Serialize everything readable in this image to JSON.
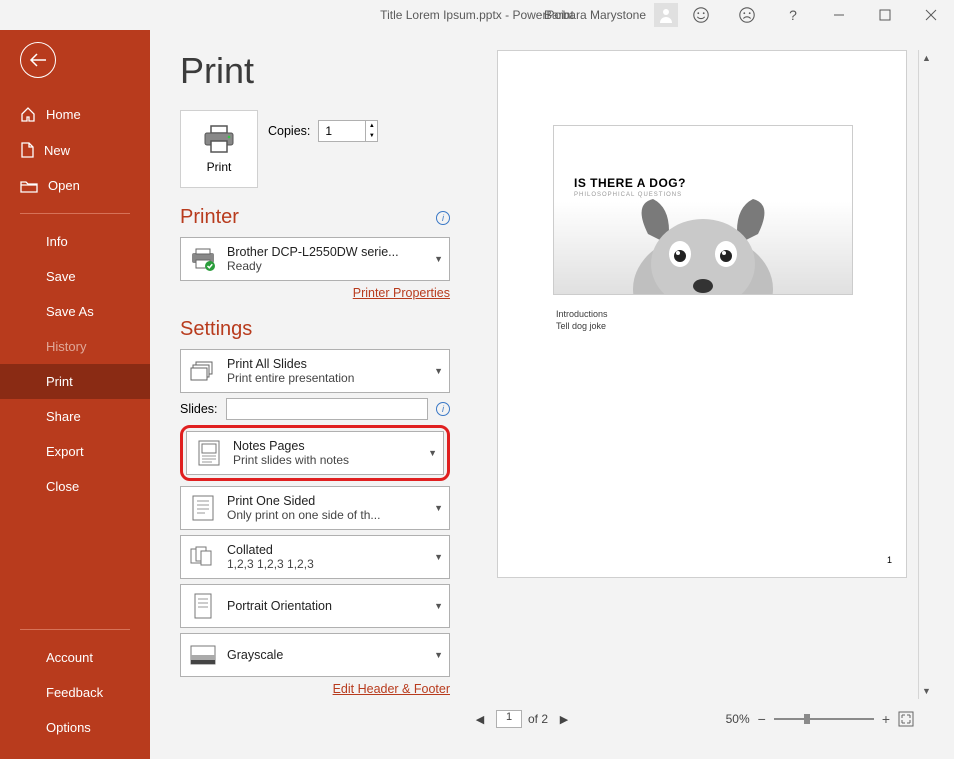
{
  "titlebar": {
    "title": "Title Lorem Ipsum.pptx  -  PowerPoint",
    "user": "Barbara Marystone"
  },
  "sidebar": {
    "top": [
      {
        "label": "Home",
        "icon": "home"
      },
      {
        "label": "New",
        "icon": "new"
      },
      {
        "label": "Open",
        "icon": "open"
      }
    ],
    "mid": [
      {
        "label": "Info"
      },
      {
        "label": "Save"
      },
      {
        "label": "Save As"
      },
      {
        "label": "History",
        "dim": true
      },
      {
        "label": "Print",
        "selected": true
      },
      {
        "label": "Share"
      },
      {
        "label": "Export"
      },
      {
        "label": "Close"
      }
    ],
    "bottom": [
      {
        "label": "Account"
      },
      {
        "label": "Feedback"
      },
      {
        "label": "Options"
      }
    ]
  },
  "print": {
    "pageTitle": "Print",
    "button": "Print",
    "copiesLabel": "Copies:",
    "copies": "1",
    "printer": {
      "heading": "Printer",
      "name": "Brother DCP-L2550DW serie...",
      "status": "Ready",
      "propertiesLink": "Printer Properties"
    },
    "settings": {
      "heading": "Settings",
      "items": [
        {
          "title": "Print All Slides",
          "sub": "Print entire presentation"
        },
        {
          "title": "Notes Pages",
          "sub": "Print slides with notes"
        },
        {
          "title": "Print One Sided",
          "sub": "Only print on one side of th..."
        },
        {
          "title": "Collated",
          "sub": "1,2,3    1,2,3    1,2,3"
        },
        {
          "title": "Portrait Orientation",
          "sub": ""
        },
        {
          "title": "Grayscale",
          "sub": ""
        }
      ],
      "slidesLabel": "Slides:",
      "editHeaderFooter": "Edit Header & Footer"
    }
  },
  "preview": {
    "slideTitle": "IS THERE A DOG?",
    "slideSubtitle": "PHILOSOPHICAL QUESTIONS",
    "notes": [
      "Introductions",
      "Tell dog joke"
    ],
    "pageNumber": "1",
    "pager": {
      "current": "1",
      "totalLabel": "of 2"
    },
    "zoom": {
      "percent": "50%"
    }
  }
}
